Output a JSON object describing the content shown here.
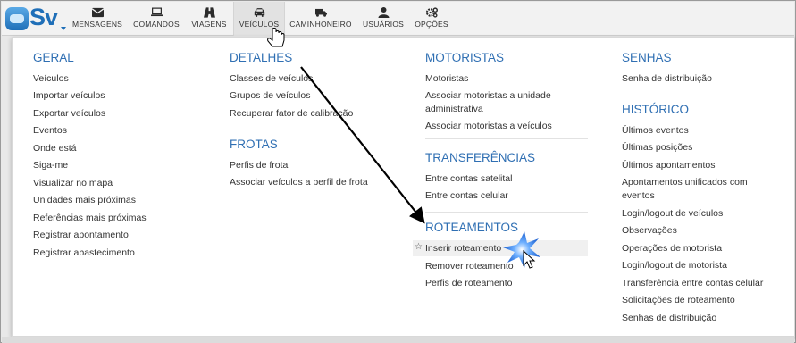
{
  "brand": {
    "name": "Sv",
    "accent": "#2f6fb3"
  },
  "nav": [
    {
      "label": "MENSAGENS",
      "icon": "envelope-icon"
    },
    {
      "label": "COMANDOS",
      "icon": "laptop-icon"
    },
    {
      "label": "VIAGENS",
      "icon": "road-icon"
    },
    {
      "label": "VEÍCULOS",
      "icon": "car-icon",
      "active": true
    },
    {
      "label": "CAMINHONEIRO",
      "icon": "truck-icon"
    },
    {
      "label": "USUÁRIOS",
      "icon": "user-icon"
    },
    {
      "label": "OPÇÕES",
      "icon": "gears-icon"
    }
  ],
  "columns": {
    "geral": {
      "title": "GERAL",
      "items": [
        "Veículos",
        "Importar veículos",
        "Exportar veículos",
        "Eventos",
        "Onde está",
        "Siga-me",
        "Visualizar no mapa",
        "Unidades mais próximas",
        "Referências mais próximas",
        "Registrar apontamento",
        "Registrar abastecimento"
      ]
    },
    "detalhes": {
      "title": "DETALHES",
      "items": [
        "Classes de veículos",
        "Grupos de veículos",
        "Recuperar fator de calibração"
      ]
    },
    "frotas": {
      "title": "FROTAS",
      "items": [
        "Perfis de frota",
        "Associar veículos a perfil de frota"
      ]
    },
    "motoristas": {
      "title": "MOTORISTAS",
      "items": [
        "Motoristas",
        "Associar motoristas a unidade",
        "administrativa",
        "Associar motoristas a veículos"
      ]
    },
    "transferencias": {
      "title": "TRANSFERÊNCIAS",
      "items": [
        "Entre contas satelital",
        "Entre contas celular"
      ]
    },
    "roteamentos": {
      "title": "ROTEAMENTOS",
      "items": [
        "Inserir roteamento",
        "Remover roteamento",
        "Perfis de roteamento"
      ]
    },
    "senhas": {
      "title": "SENHAS",
      "items": [
        "Senha de distribuição"
      ]
    },
    "historico": {
      "title": "HISTÓRICO",
      "items": [
        "Últimos eventos",
        "Últimas posições",
        "Últimos apontamentos",
        "Apontamentos unificados com",
        "eventos",
        "Login/logout de veículos",
        "Observações",
        "Operações de motorista",
        "Login/logout de motorista",
        "Transferência entre contas celular",
        "Solicitações de roteamento",
        "Senhas de distribuição"
      ]
    }
  }
}
